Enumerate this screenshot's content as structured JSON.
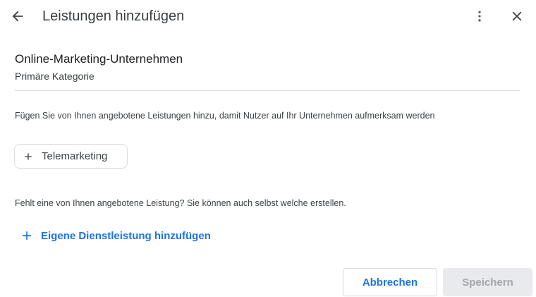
{
  "header": {
    "title": "Leistungen hinzufügen",
    "back_icon": "arrow-back-icon",
    "more_icon": "more-vert-icon",
    "close_icon": "close-icon"
  },
  "category": {
    "name": "Online-Marketing-Unternehmen",
    "label": "Primäre Kategorie"
  },
  "hint_text": "Fügen Sie von Ihnen angebotene Leistungen hinzu, damit Nutzer auf Ihr Unternehmen aufmerksam werden",
  "suggested_services": [
    {
      "label": "Telemarketing",
      "icon": "plus-icon"
    }
  ],
  "missing_text": "Fehlt eine von Ihnen angebotene Leistung? Sie können auch selbst welche erstellen.",
  "add_custom": {
    "label": "Eigene Dienstleistung hinzufügen",
    "icon": "plus-icon"
  },
  "footer": {
    "cancel_label": "Abbrechen",
    "save_label": "Speichern"
  },
  "colors": {
    "accent": "#1a73e8",
    "text": "#202124",
    "secondary_text": "#3c4043",
    "border": "#dadce0",
    "disabled_bg": "#e8eaed",
    "disabled_text": "#a4a7ab"
  }
}
